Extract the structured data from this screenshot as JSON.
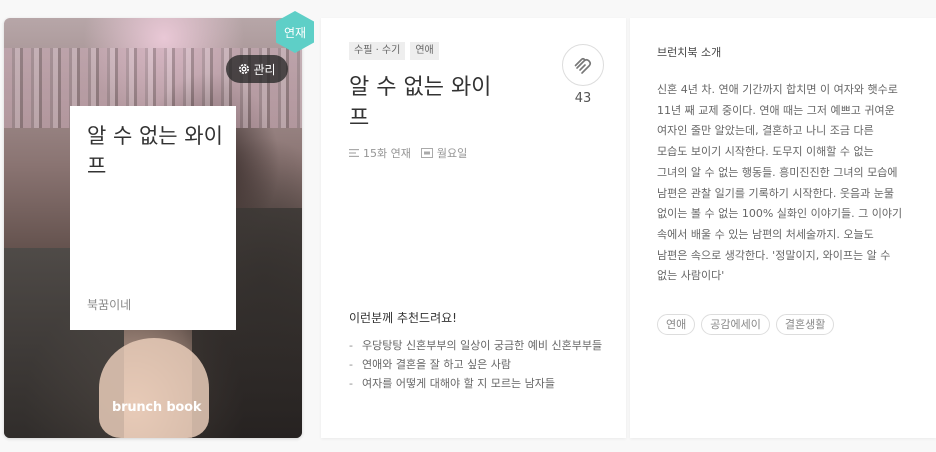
{
  "cover": {
    "title": "알 수 없는 와이프",
    "author": "북꿈이네",
    "brand": "brunch book",
    "manage_label": "관리",
    "badge_label": "연재",
    "badge_color": "#5ecfc7"
  },
  "detail": {
    "tags": [
      "수필 · 수기",
      "연애"
    ],
    "title": "알 수 없는 와이프",
    "like_count": "43",
    "episodes": "15화 연재",
    "day": "월요일",
    "rec_title": "이런분께 추천드려요!",
    "rec_items": [
      "우당탕탕 신혼부부의 일상이 궁금한 예비 신혼부부들",
      "연애와 결혼을 잘 하고 싶은 사람",
      "여자를 어떻게 대해야 할 지 모르는 남자들"
    ]
  },
  "intro": {
    "heading": "브런치북 소개",
    "body": "신혼 4년 차. 연애 기간까지 합치면 이 여자와 햇수로 11년 째 교제 중이다. 연애 때는 그저 예쁘고 귀여운 여자인 줄만 알았는데, 결혼하고 나니 조금 다른 모습도 보이기 시작한다. 도무지 이해할 수 없는 그녀의 알 수 없는 행동들. 흥미진진한 그녀의 모습에 남편은 관찰 일기를 기록하기 시작한다. 웃음과 눈물 없이는 볼 수 없는 100% 실화인 이야기들. 그 이야기 속에서 배울 수 있는 남편의 처세술까지. 오늘도 남편은 속으로 생각한다. '정말이지, 와이프는 알 수 없는 사람이다'",
    "keywords": [
      "연애",
      "공감에세이",
      "결혼생활"
    ]
  }
}
